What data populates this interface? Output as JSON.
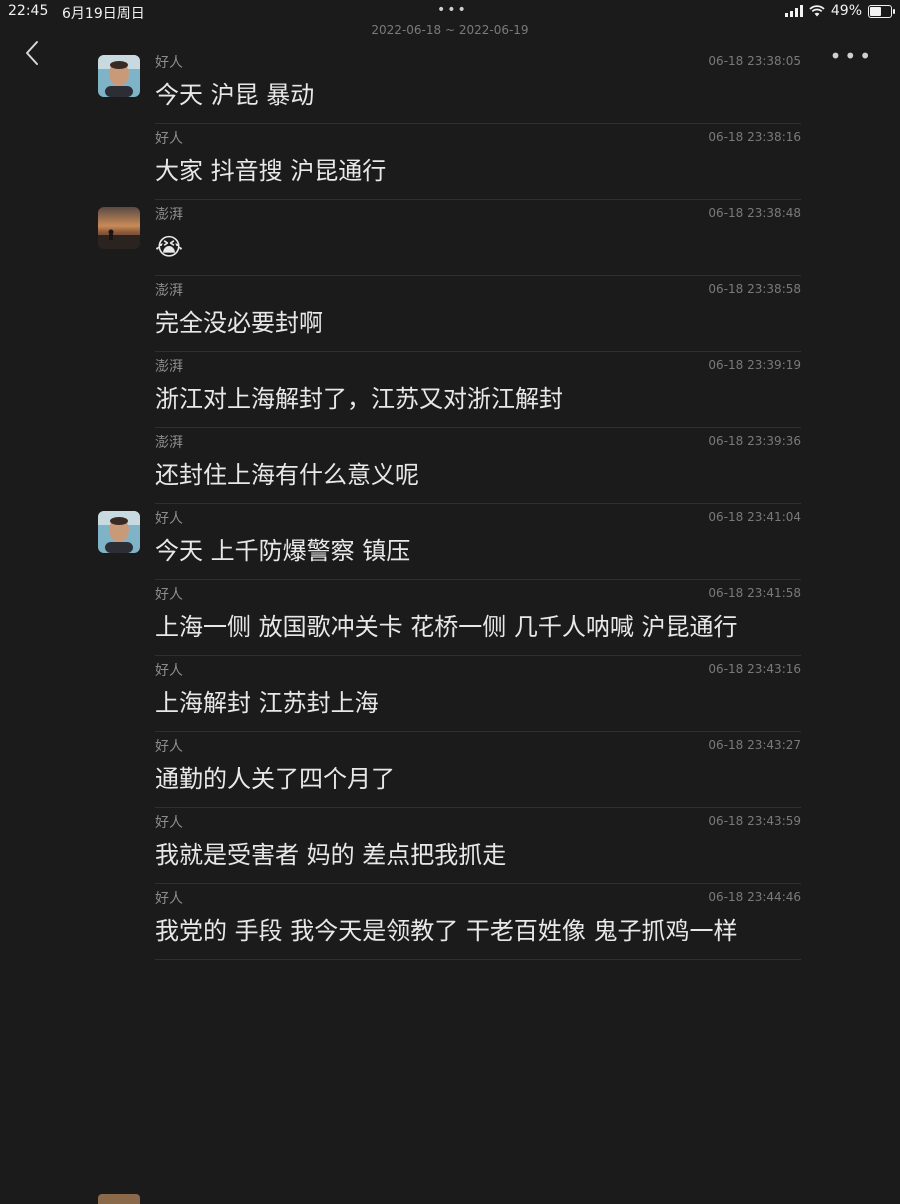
{
  "status_bar": {
    "time": "22:45",
    "date": "6月19日周日",
    "dots": "•••",
    "battery": "49%",
    "battery_level": 0.49
  },
  "header": {
    "date_range": "2022-06-18 ~ 2022-06-19",
    "more": "•••"
  },
  "messages": [
    {
      "sender": "好人",
      "time": "06-18 23:38:05",
      "text": "今天 沪昆 暴动",
      "avatar": "person"
    },
    {
      "sender": "好人",
      "time": "06-18 23:38:16",
      "text": "大家 抖音搜 沪昆通行"
    },
    {
      "sender": "澎湃",
      "time": "06-18 23:38:48",
      "text": "😭",
      "avatar": "sunset"
    },
    {
      "sender": "澎湃",
      "time": "06-18 23:38:58",
      "text": "完全没必要封啊"
    },
    {
      "sender": "澎湃",
      "time": "06-18 23:39:19",
      "text": "浙江对上海解封了，江苏又对浙江解封"
    },
    {
      "sender": "澎湃",
      "time": "06-18 23:39:36",
      "text": "还封住上海有什么意义呢"
    },
    {
      "sender": "好人",
      "time": "06-18 23:41:04",
      "text": "今天 上千防爆警察 镇压",
      "avatar": "person"
    },
    {
      "sender": "好人",
      "time": "06-18 23:41:58",
      "text": "上海一侧 放国歌冲关卡 花桥一侧 几千人呐喊 沪昆通行"
    },
    {
      "sender": "好人",
      "time": "06-18 23:43:16",
      "text": "上海解封 江苏封上海"
    },
    {
      "sender": "好人",
      "time": "06-18 23:43:27",
      "text": "通勤的人关了四个月了"
    },
    {
      "sender": "好人",
      "time": "06-18 23:43:59",
      "text": "我就是受害者 妈的 差点把我抓走"
    },
    {
      "sender": "好人",
      "time": "06-18 23:44:46",
      "text": "我党的 手段 我今天是领教了 干老百姓像 鬼子抓鸡一样"
    }
  ]
}
